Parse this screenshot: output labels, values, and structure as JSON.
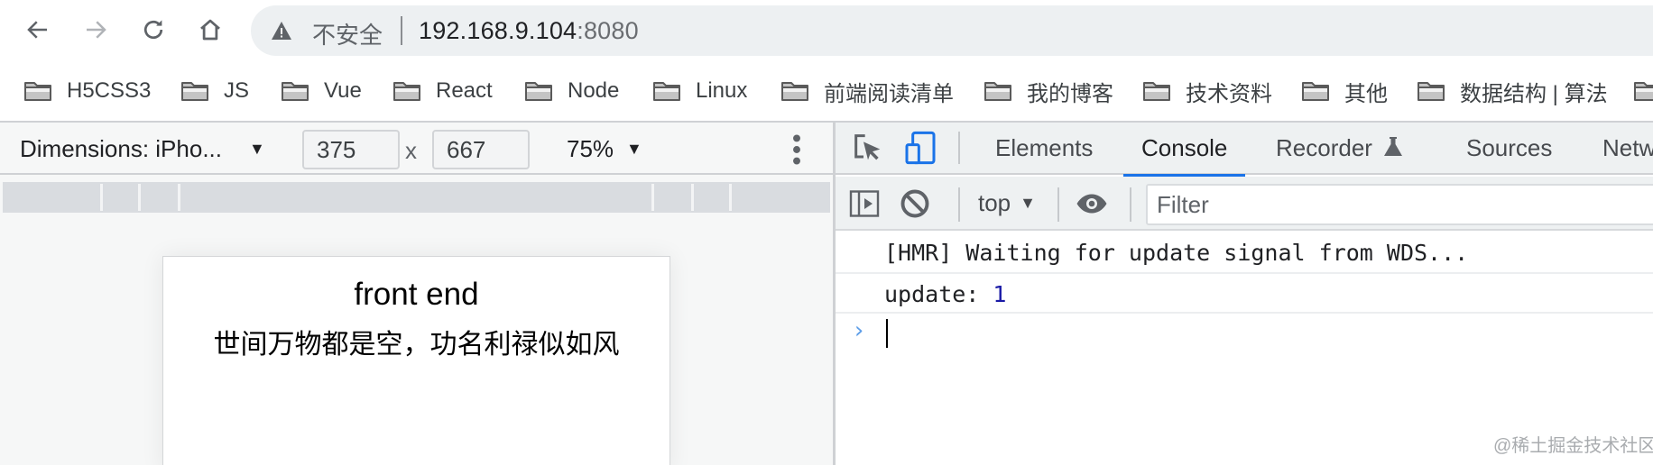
{
  "browser": {
    "nav": {
      "back": "back-icon",
      "forward": "forward-icon",
      "reload": "reload-icon",
      "home": "home-icon"
    },
    "address_bar": {
      "security_label": "不安全",
      "host": "192.168.9.104",
      "port": ":8080"
    },
    "bookmarks": [
      {
        "label": "H5CSS3"
      },
      {
        "label": "JS"
      },
      {
        "label": "Vue"
      },
      {
        "label": "React"
      },
      {
        "label": "Node"
      },
      {
        "label": "Linux"
      },
      {
        "label": "前端阅读清单"
      },
      {
        "label": "我的博客"
      },
      {
        "label": "技术资料"
      },
      {
        "label": "其他"
      },
      {
        "label": "数据结构 | 算法"
      },
      {
        "label": ""
      }
    ]
  },
  "device_toolbar": {
    "dimensions_label": "Dimensions: iPho...",
    "width": "375",
    "times": "x",
    "height": "667",
    "zoom": "75%"
  },
  "page_preview": {
    "title": "front end",
    "subtitle": "世间万物都是空，功名利禄似如风"
  },
  "devtools": {
    "tabs": [
      {
        "label": "Elements",
        "active": false
      },
      {
        "label": "Console",
        "active": true
      },
      {
        "label": "Recorder",
        "active": false,
        "badge": "flask-icon"
      },
      {
        "label": "Sources",
        "active": false
      },
      {
        "label": "Netw",
        "active": false
      }
    ],
    "console_toolbar": {
      "context": "top",
      "filter_placeholder": "Filter"
    },
    "console_logs": [
      {
        "text": "[HMR] Waiting for update signal from WDS..."
      },
      {
        "text": "update: ",
        "value": "1"
      }
    ],
    "accent_color": "#1a73e8"
  },
  "watermark": "@稀土掘金技术社区"
}
